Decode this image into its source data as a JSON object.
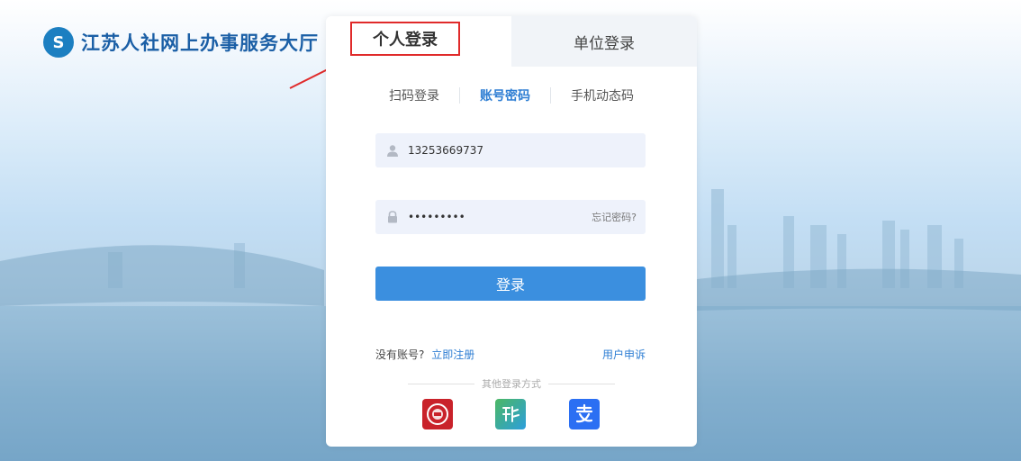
{
  "brand": {
    "logo_glyph": "S",
    "title": "江苏人社网上办事服务大厅"
  },
  "tabs": {
    "personal": "个人登录",
    "unit": "单位登录"
  },
  "subtabs": [
    "扫码登录",
    "账号密码",
    "手机动态码"
  ],
  "form": {
    "username_value": "13253669737",
    "password_value": "•••••••••",
    "forgot_password": "忘记密码?",
    "login_button": "登录"
  },
  "footer": {
    "register_prompt": "没有账号?",
    "register_link": "立即注册",
    "appeal_link": "用户申诉",
    "other_methods": "其他登录方式"
  },
  "icons": {
    "user": "user-icon",
    "lock": "lock-icon",
    "app1": "social-security-app-icon",
    "app2": "su-service-app-icon",
    "app3": "alipay-icon"
  },
  "colors": {
    "accent": "#3b8fdf",
    "highlight": "#e02a2a"
  }
}
